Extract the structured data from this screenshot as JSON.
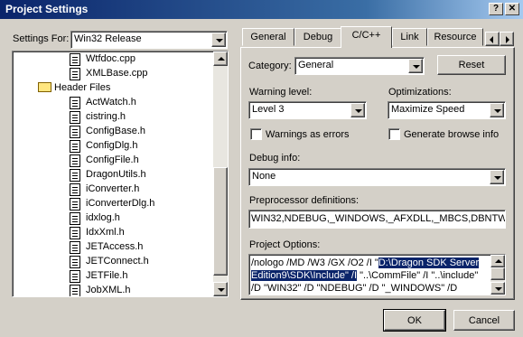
{
  "window": {
    "title": "Project Settings",
    "help_btn": "?",
    "close_btn": "✕"
  },
  "left": {
    "settings_label": "Settings For:",
    "settings_value": "Win32 Release",
    "tree": [
      {
        "label": "Wtfdoc.cpp",
        "type": "file"
      },
      {
        "label": "XMLBase.cpp",
        "type": "file"
      },
      {
        "label": "Header Files",
        "type": "folder"
      },
      {
        "label": "ActWatch.h",
        "type": "file"
      },
      {
        "label": "cistring.h",
        "type": "file"
      },
      {
        "label": "ConfigBase.h",
        "type": "file"
      },
      {
        "label": "ConfigDlg.h",
        "type": "file"
      },
      {
        "label": "ConfigFile.h",
        "type": "file"
      },
      {
        "label": "DragonUtils.h",
        "type": "file"
      },
      {
        "label": "iConverter.h",
        "type": "file"
      },
      {
        "label": "iConverterDlg.h",
        "type": "file"
      },
      {
        "label": "idxlog.h",
        "type": "file"
      },
      {
        "label": "IdxXml.h",
        "type": "file"
      },
      {
        "label": "JETAccess.h",
        "type": "file"
      },
      {
        "label": "JETConnect.h",
        "type": "file"
      },
      {
        "label": "JETFile.h",
        "type": "file"
      },
      {
        "label": "JobXML.h",
        "type": "file"
      }
    ]
  },
  "tabs": [
    "General",
    "Debug",
    "C/C++",
    "Link",
    "Resource"
  ],
  "active_tab": "C/C++",
  "right": {
    "category_label": "Category:",
    "category_value": "General",
    "reset_label": "Reset",
    "warning_label": "Warning level:",
    "warning_value": "Level 3",
    "optim_label": "Optimizations:",
    "optim_value": "Maximize Speed",
    "warn_errors_label": "Warnings as errors",
    "browse_label": "Generate browse info",
    "debug_label": "Debug info:",
    "debug_value": "None",
    "preproc_label": "Preprocessor definitions:",
    "preproc_value": "WIN32,NDEBUG,_WINDOWS,_AFXDLL,_MBCS,DBNTW",
    "options_label": "Project Options:",
    "options_line1_a": "/nologo /MD /W3 /GX /O2 /I \"",
    "options_line1_sel": "D:\\Dragon SDK Server",
    "options_line2_sel": "Edition9\\SDK\\Include\" /I",
    "options_line2_b": " \"..\\CommFile\" /I \"..\\include\"",
    "options_line3": "/D \"WIN32\" /D \"NDEBUG\" /D \"_WINDOWS\" /D"
  },
  "buttons": {
    "ok": "OK",
    "cancel": "Cancel"
  }
}
